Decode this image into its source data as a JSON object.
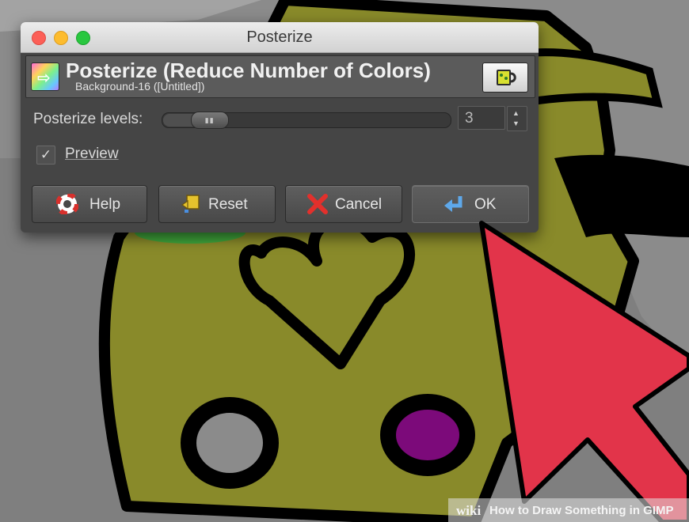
{
  "window": {
    "title": "Posterize"
  },
  "header": {
    "title": "Posterize (Reduce Number of Colors)",
    "subtitle": "Background-16 ([Untitled])",
    "icon": "posterize-icon",
    "action_icon": "coffee-cup-icon"
  },
  "levels": {
    "label": "Posterize levels:",
    "value": "3",
    "slider_fraction": 0.04
  },
  "preview": {
    "label": "Preview",
    "checked": true
  },
  "buttons": {
    "help": "Help",
    "reset": "Reset",
    "cancel": "Cancel",
    "ok": "OK"
  },
  "watermark": {
    "brand": "wiki",
    "text": "How to Draw Something in GIMP"
  },
  "colors": {
    "canvas_gray": "#8b8b8b",
    "mustard": "#898a2a",
    "outline": "#000000",
    "purple": "#7c0a7a",
    "green": "#3fa43b",
    "cursor_red": "#e2344a"
  }
}
